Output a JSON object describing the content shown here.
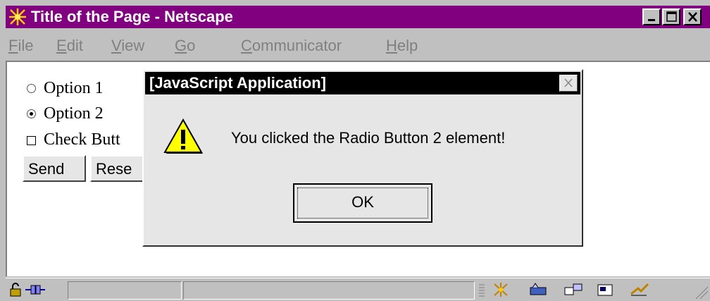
{
  "window": {
    "title": "Title of the Page - Netscape",
    "titlebar_color": "#800080",
    "controls": {
      "minimize": "minimize-icon",
      "maximize": "maximize-icon",
      "close": "close-icon"
    }
  },
  "menu": {
    "items": [
      {
        "mnemonic": "F",
        "rest": "ile"
      },
      {
        "mnemonic": "E",
        "rest": "dit"
      },
      {
        "mnemonic": "V",
        "rest": "iew"
      },
      {
        "mnemonic": "G",
        "rest": "o"
      },
      {
        "mnemonic": "C",
        "rest": "ommunicator"
      },
      {
        "mnemonic": "H",
        "rest": "elp"
      }
    ]
  },
  "form": {
    "option1": {
      "label": "Option 1",
      "checked": false
    },
    "option2": {
      "label": "Option 2",
      "checked": true
    },
    "checkbox": {
      "label": "Check Butt",
      "checked": false
    },
    "send_label": "Send",
    "reset_label": "Rese"
  },
  "dialog": {
    "title": "[JavaScript Application]",
    "message": "You clicked the Radio Button 2 element!",
    "ok_label": "OK",
    "icon": "warning-icon"
  },
  "statusbar": {
    "icons": [
      "security-lock-icon",
      "connection-icon",
      "navigator-icon",
      "mailbox-icon",
      "discussion-icon",
      "composer-icon",
      "bookmark-icon"
    ]
  }
}
